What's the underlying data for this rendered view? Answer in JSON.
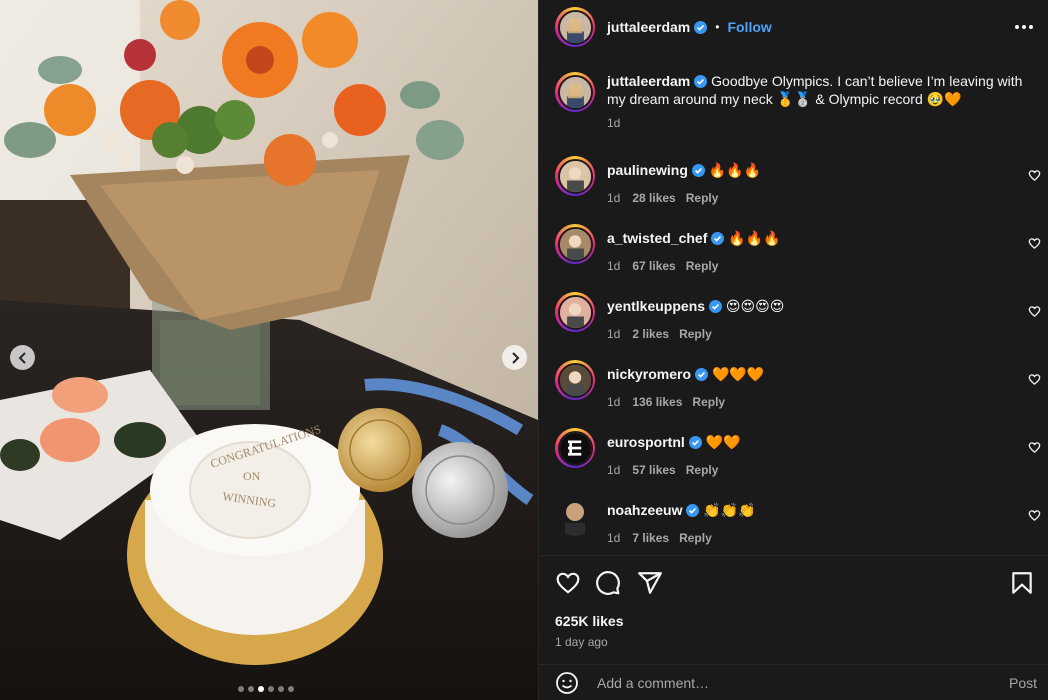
{
  "post": {
    "author": "juttaleerdam",
    "follow_label": "Follow",
    "separator": "•"
  },
  "caption": {
    "username": "juttaleerdam",
    "text": "Goodbye Olympics. I can’t believe I’m leaving with my dream around my neck 🥇🥈 & Olympic record 🥹🧡",
    "time": "1d"
  },
  "cake_text": [
    "CONGRATULATIONS",
    "ON",
    "WINNING"
  ],
  "carousel": {
    "count": 6,
    "active": 2
  },
  "comments": [
    {
      "username": "paulinewing",
      "text": "🔥🔥🔥",
      "time": "1d",
      "likes": "28 likes",
      "reply": "Reply",
      "verified": true
    },
    {
      "username": "a_twisted_chef",
      "text": "🔥🔥🔥",
      "time": "1d",
      "likes": "67 likes",
      "reply": "Reply",
      "verified": true
    },
    {
      "username": "yentlkeuppens",
      "text": "😍😍😍😍",
      "time": "1d",
      "likes": "2 likes",
      "reply": "Reply",
      "verified": true
    },
    {
      "username": "nickyromero",
      "text": "🧡🧡🧡",
      "time": "1d",
      "likes": "136 likes",
      "reply": "Reply",
      "verified": true
    },
    {
      "username": "eurosportnl",
      "text": "🧡🧡",
      "time": "1d",
      "likes": "57 likes",
      "reply": "Reply",
      "verified": true
    },
    {
      "username": "noahzeeuw",
      "text": "👏👏👏",
      "time": "1d",
      "likes": "7 likes",
      "reply": "Reply",
      "verified": true
    }
  ],
  "stats": {
    "likes": "625K likes",
    "time_ago": "1 day ago"
  },
  "composer": {
    "placeholder": "Add a comment…",
    "post_label": "Post"
  },
  "colors": {
    "panel_bg": "#1a1a1a",
    "link_blue": "#4ca3f8",
    "muted": "#a8a8a8",
    "verified_blue": "#3897f0"
  }
}
